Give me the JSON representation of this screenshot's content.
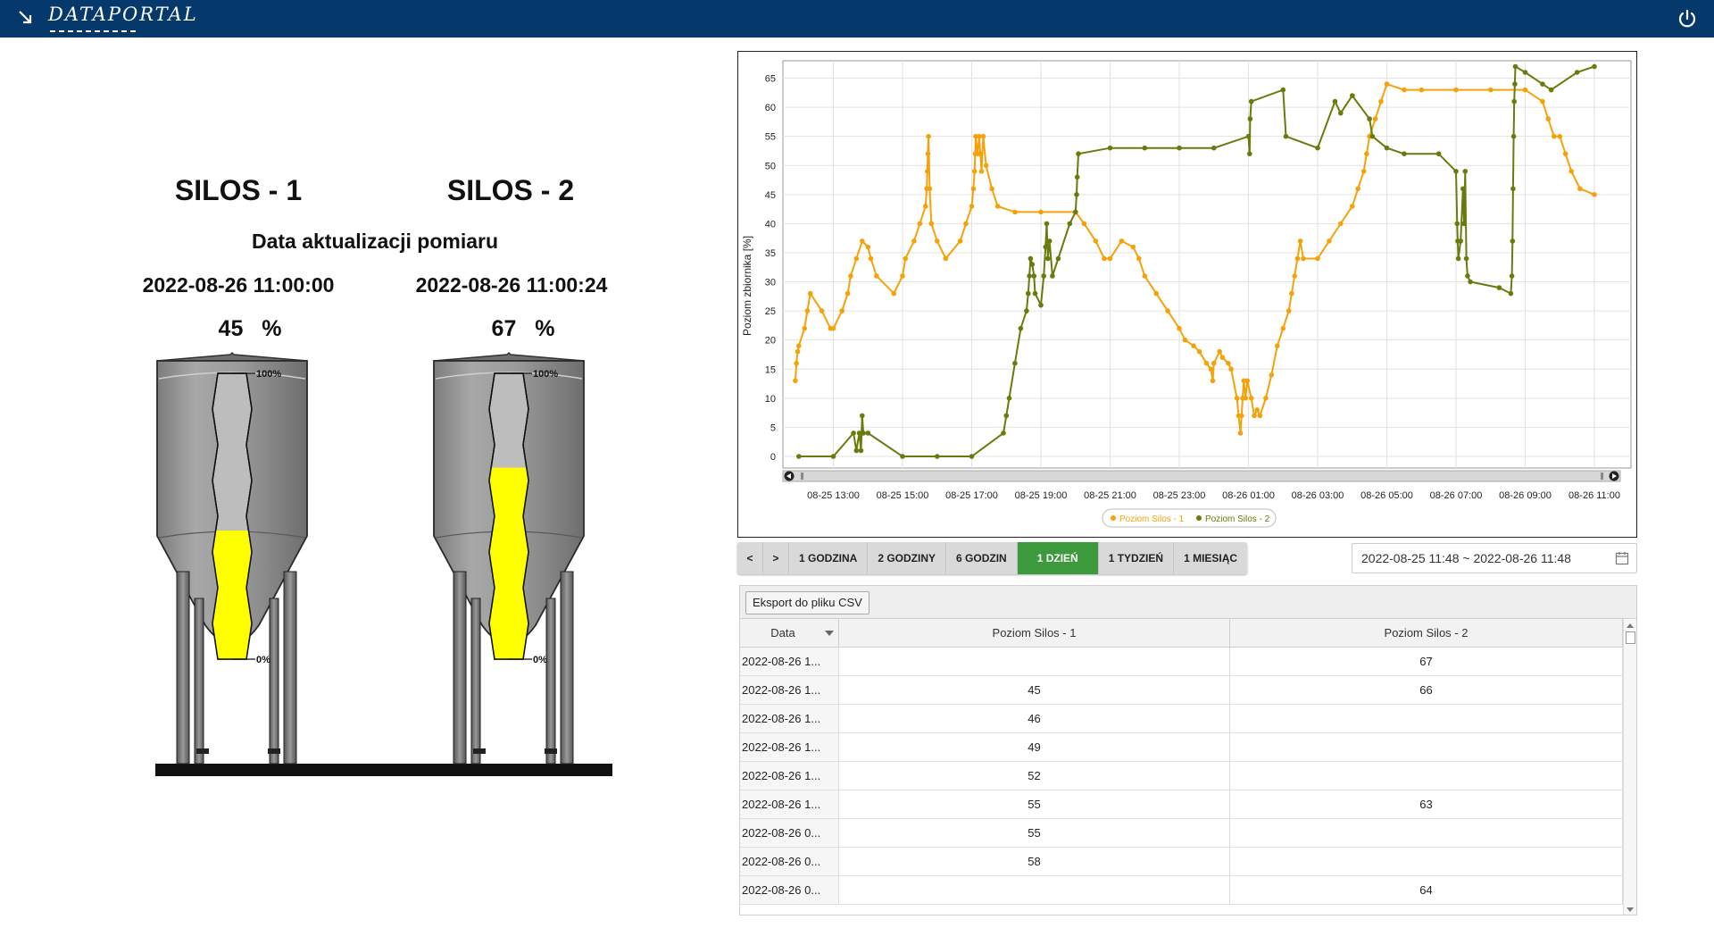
{
  "header": {
    "logo_text": "DATAPORTAL"
  },
  "silos": [
    {
      "title": "SILOS - 1",
      "datetime": "2022-08-26 11:00:00",
      "value": "45",
      "unit": "%",
      "level": 0.45
    },
    {
      "title": "SILOS - 2",
      "datetime": "2022-08-26 11:00:24",
      "value": "67",
      "unit": "%",
      "level": 0.67
    }
  ],
  "update_label": "Data aktualizacji pomiaru",
  "gauge_labels": {
    "top": "100%",
    "bottom": "0%"
  },
  "colors": {
    "silos1": "#f5a20a",
    "silos2": "#6b7a0c",
    "active_button": "#3c9a3c",
    "header": "#05386b",
    "fill": "#ffff00"
  },
  "chart_data": {
    "type": "line",
    "ylabel": "Poziom zbiornika [%]",
    "xlabel": "",
    "ylim": [
      -2,
      68
    ],
    "yticks": [
      0,
      5,
      10,
      15,
      20,
      25,
      30,
      35,
      40,
      45,
      50,
      55,
      60,
      65
    ],
    "xlim": [
      "08-25 11:48",
      "08-26 11:48"
    ],
    "xticks": [
      "08-25 13:00",
      "08-25 15:00",
      "08-25 17:00",
      "08-25 19:00",
      "08-25 21:00",
      "08-25 23:00",
      "08-26 01:00",
      "08-26 03:00",
      "08-26 05:00",
      "08-26 07:00",
      "08-26 09:00",
      "08-26 11:00"
    ],
    "grid": true,
    "legend": "bottom",
    "series": [
      {
        "name": "Poziom Silos - 1",
        "points": [
          [
            "08-25 11:54",
            13
          ],
          [
            "08-25 11:56",
            16
          ],
          [
            "08-25 11:58",
            18
          ],
          [
            "08-25 12:00",
            19
          ],
          [
            "08-25 12:10",
            22
          ],
          [
            "08-25 12:15",
            25
          ],
          [
            "08-25 12:20",
            28
          ],
          [
            "08-25 12:40",
            25
          ],
          [
            "08-25 12:55",
            22
          ],
          [
            "08-25 13:00",
            22
          ],
          [
            "08-25 13:15",
            25
          ],
          [
            "08-25 13:25",
            28
          ],
          [
            "08-25 13:30",
            31
          ],
          [
            "08-25 13:40",
            34
          ],
          [
            "08-25 13:50",
            37
          ],
          [
            "08-25 14:00",
            36
          ],
          [
            "08-25 14:05",
            34
          ],
          [
            "08-25 14:15",
            31
          ],
          [
            "08-25 14:45",
            28
          ],
          [
            "08-25 15:00",
            31
          ],
          [
            "08-25 15:05",
            34
          ],
          [
            "08-25 15:20",
            37
          ],
          [
            "08-25 15:30",
            40
          ],
          [
            "08-25 15:40",
            43
          ],
          [
            "08-25 15:42",
            46
          ],
          [
            "08-25 15:43",
            49
          ],
          [
            "08-25 15:44",
            52
          ],
          [
            "08-25 15:45",
            55
          ],
          [
            "08-25 15:47",
            46
          ],
          [
            "08-25 15:50",
            40
          ],
          [
            "08-25 16:00",
            37
          ],
          [
            "08-25 16:15",
            34
          ],
          [
            "08-25 16:40",
            37
          ],
          [
            "08-25 16:50",
            40
          ],
          [
            "08-25 17:00",
            43
          ],
          [
            "08-25 17:03",
            46
          ],
          [
            "08-25 17:05",
            49
          ],
          [
            "08-25 17:06",
            52
          ],
          [
            "08-25 17:07",
            55
          ],
          [
            "08-25 17:10",
            52
          ],
          [
            "08-25 17:13",
            55
          ],
          [
            "08-25 17:15",
            52
          ],
          [
            "08-25 17:17",
            49
          ],
          [
            "08-25 17:20",
            55
          ],
          [
            "08-25 17:25",
            50
          ],
          [
            "08-25 17:35",
            46
          ],
          [
            "08-25 17:45",
            43
          ],
          [
            "08-25 18:15",
            42
          ],
          [
            "08-25 19:00",
            42
          ],
          [
            "08-25 20:00",
            42
          ],
          [
            "08-25 20:15",
            40
          ],
          [
            "08-25 20:35",
            37
          ],
          [
            "08-25 20:50",
            34
          ],
          [
            "08-25 21:00",
            34
          ],
          [
            "08-25 21:20",
            37
          ],
          [
            "08-25 21:40",
            36
          ],
          [
            "08-25 21:50",
            34
          ],
          [
            "08-25 22:00",
            31
          ],
          [
            "08-25 22:20",
            28
          ],
          [
            "08-25 22:40",
            25
          ],
          [
            "08-25 23:00",
            22
          ],
          [
            "08-25 23:10",
            20
          ],
          [
            "08-25 23:25",
            19
          ],
          [
            "08-25 23:35",
            18
          ],
          [
            "08-25 23:47",
            16
          ],
          [
            "08-25 23:55",
            15
          ],
          [
            "08-25 23:58",
            13
          ],
          [
            "08-26 00:00",
            16
          ],
          [
            "08-26 00:10",
            18
          ],
          [
            "08-26 00:15",
            17
          ],
          [
            "08-26 00:25",
            16
          ],
          [
            "08-26 00:30",
            15
          ],
          [
            "08-26 00:40",
            10
          ],
          [
            "08-26 00:43",
            7
          ],
          [
            "08-26 00:46",
            4
          ],
          [
            "08-26 00:48",
            7
          ],
          [
            "08-26 00:50",
            10
          ],
          [
            "08-26 00:52",
            13
          ],
          [
            "08-26 00:55",
            10
          ],
          [
            "08-26 00:58",
            13
          ],
          [
            "08-26 01:05",
            10
          ],
          [
            "08-26 01:10",
            7
          ],
          [
            "08-26 01:15",
            8
          ],
          [
            "08-26 01:20",
            7
          ],
          [
            "08-26 01:30",
            10
          ],
          [
            "08-26 01:40",
            14
          ],
          [
            "08-26 01:50",
            19
          ],
          [
            "08-26 02:00",
            22
          ],
          [
            "08-26 02:10",
            25
          ],
          [
            "08-26 02:15",
            28
          ],
          [
            "08-26 02:20",
            31
          ],
          [
            "08-26 02:25",
            34
          ],
          [
            "08-26 02:30",
            37
          ],
          [
            "08-26 02:35",
            34
          ],
          [
            "08-26 03:00",
            34
          ],
          [
            "08-26 03:20",
            37
          ],
          [
            "08-26 03:40",
            40
          ],
          [
            "08-26 04:00",
            43
          ],
          [
            "08-26 04:10",
            46
          ],
          [
            "08-26 04:20",
            49
          ],
          [
            "08-26 04:25",
            52
          ],
          [
            "08-26 04:30",
            55
          ],
          [
            "08-26 04:40",
            58
          ],
          [
            "08-26 04:50",
            61
          ],
          [
            "08-26 05:00",
            64
          ],
          [
            "08-26 05:30",
            63
          ],
          [
            "08-26 06:00",
            63
          ],
          [
            "08-26 07:00",
            63
          ],
          [
            "08-26 08:00",
            63
          ],
          [
            "08-26 09:00",
            63
          ],
          [
            "08-26 09:30",
            61
          ],
          [
            "08-26 09:40",
            58
          ],
          [
            "08-26 09:50",
            55
          ],
          [
            "08-26 10:00",
            55
          ],
          [
            "08-26 10:10",
            52
          ],
          [
            "08-26 10:20",
            49
          ],
          [
            "08-26 10:35",
            46
          ],
          [
            "08-26 11:00",
            45
          ]
        ]
      },
      {
        "name": "Poziom Silos - 2",
        "points": [
          [
            "08-25 12:00",
            0
          ],
          [
            "08-25 13:00",
            0
          ],
          [
            "08-25 13:35",
            4
          ],
          [
            "08-25 13:40",
            1
          ],
          [
            "08-25 13:45",
            4
          ],
          [
            "08-25 13:48",
            1
          ],
          [
            "08-25 13:50",
            7
          ],
          [
            "08-25 13:52",
            4
          ],
          [
            "08-25 14:00",
            4
          ],
          [
            "08-25 15:00",
            0
          ],
          [
            "08-25 16:00",
            0
          ],
          [
            "08-25 17:00",
            0
          ],
          [
            "08-25 17:55",
            4
          ],
          [
            "08-25 18:00",
            7
          ],
          [
            "08-25 18:05",
            10
          ],
          [
            "08-25 18:15",
            16
          ],
          [
            "08-25 18:25",
            22
          ],
          [
            "08-25 18:35",
            25
          ],
          [
            "08-25 18:38",
            28
          ],
          [
            "08-25 18:40",
            31
          ],
          [
            "08-25 18:42",
            34
          ],
          [
            "08-25 18:45",
            33
          ],
          [
            "08-25 18:48",
            31
          ],
          [
            "08-25 18:50",
            28
          ],
          [
            "08-25 19:00",
            26
          ],
          [
            "08-25 19:05",
            31
          ],
          [
            "08-25 19:08",
            36
          ],
          [
            "08-25 19:10",
            40
          ],
          [
            "08-25 19:12",
            34
          ],
          [
            "08-25 19:15",
            37
          ],
          [
            "08-25 19:20",
            31
          ],
          [
            "08-25 19:30",
            34
          ],
          [
            "08-25 19:50",
            40
          ],
          [
            "08-25 20:00",
            42
          ],
          [
            "08-25 20:02",
            45
          ],
          [
            "08-25 20:03",
            48
          ],
          [
            "08-25 20:05",
            52
          ],
          [
            "08-25 21:00",
            53
          ],
          [
            "08-25 22:00",
            53
          ],
          [
            "08-25 23:00",
            53
          ],
          [
            "08-26 00:00",
            53
          ],
          [
            "08-26 01:00",
            55
          ],
          [
            "08-26 01:02",
            52
          ],
          [
            "08-26 01:03",
            58
          ],
          [
            "08-26 01:05",
            61
          ],
          [
            "08-26 02:00",
            63
          ],
          [
            "08-26 02:05",
            55
          ],
          [
            "08-26 03:00",
            53
          ],
          [
            "08-26 03:30",
            61
          ],
          [
            "08-26 03:40",
            59
          ],
          [
            "08-26 04:00",
            62
          ],
          [
            "08-26 04:30",
            58
          ],
          [
            "08-26 04:35",
            55
          ],
          [
            "08-26 05:00",
            53
          ],
          [
            "08-26 05:30",
            52
          ],
          [
            "08-26 06:30",
            52
          ],
          [
            "08-26 07:00",
            49
          ],
          [
            "08-26 07:02",
            40
          ],
          [
            "08-26 07:03",
            37
          ],
          [
            "08-26 07:04",
            34
          ],
          [
            "08-26 07:08",
            37
          ],
          [
            "08-26 07:12",
            46
          ],
          [
            "08-26 07:14",
            40
          ],
          [
            "08-26 07:16",
            49
          ],
          [
            "08-26 07:18",
            34
          ],
          [
            "08-26 07:20",
            31
          ],
          [
            "08-26 07:25",
            30
          ],
          [
            "08-26 08:15",
            29
          ],
          [
            "08-26 08:35",
            28
          ],
          [
            "08-26 08:37",
            31
          ],
          [
            "08-26 08:38",
            37
          ],
          [
            "08-26 08:39",
            46
          ],
          [
            "08-26 08:40",
            55
          ],
          [
            "08-26 08:41",
            61
          ],
          [
            "08-26 08:42",
            64
          ],
          [
            "08-26 08:43",
            67
          ],
          [
            "08-26 09:00",
            66
          ],
          [
            "08-26 09:30",
            64
          ],
          [
            "08-26 09:45",
            63
          ],
          [
            "08-26 10:30",
            66
          ],
          [
            "08-26 11:00",
            67
          ]
        ]
      }
    ]
  },
  "range_buttons": {
    "prev": "<",
    "next": ">",
    "items": [
      "1 GODZINA",
      "2 GODZINY",
      "6 GODZIN",
      "1 DZIEŃ",
      "1 TYDZIEŃ",
      "1 MIESIĄC"
    ],
    "active": "1 DZIEŃ"
  },
  "date_range": "2022-08-25 11:48 ~ 2022-08-26 11:48",
  "table": {
    "export_label": "Eksport do pliku CSV",
    "headers": [
      "Data",
      "Poziom Silos - 1",
      "Poziom Silos - 2"
    ],
    "rows": [
      [
        "2022-08-26 1...",
        "",
        "67"
      ],
      [
        "2022-08-26 1...",
        "45",
        "66"
      ],
      [
        "2022-08-26 1...",
        "46",
        ""
      ],
      [
        "2022-08-26 1...",
        "49",
        ""
      ],
      [
        "2022-08-26 1...",
        "52",
        ""
      ],
      [
        "2022-08-26 1...",
        "55",
        "63"
      ],
      [
        "2022-08-26 0...",
        "55",
        ""
      ],
      [
        "2022-08-26 0...",
        "58",
        ""
      ],
      [
        "2022-08-26 0...",
        "",
        "64"
      ]
    ]
  }
}
